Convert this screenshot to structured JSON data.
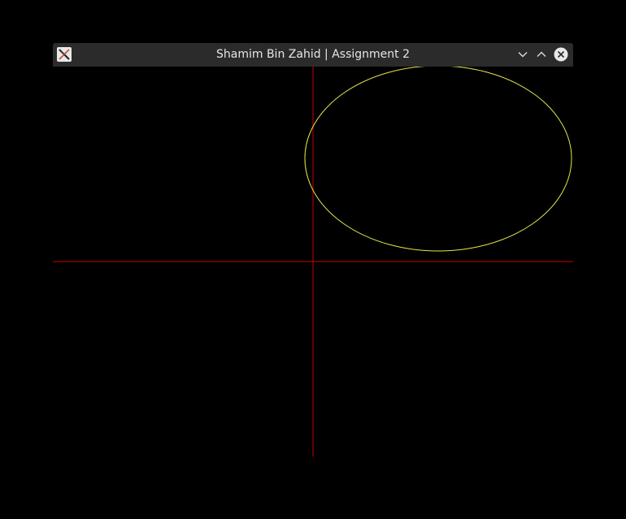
{
  "window": {
    "title": "Shamim Bin Zahid | Assignment 2",
    "app_icon": "x-window-icon",
    "buttons": {
      "minimize": "chevron-down-icon",
      "maximize": "chevron-up-icon",
      "close": "close-icon"
    }
  },
  "canvas": {
    "background": "#000000",
    "axis_color": "#cc0000",
    "ellipse_color": "#e6e64c"
  }
}
